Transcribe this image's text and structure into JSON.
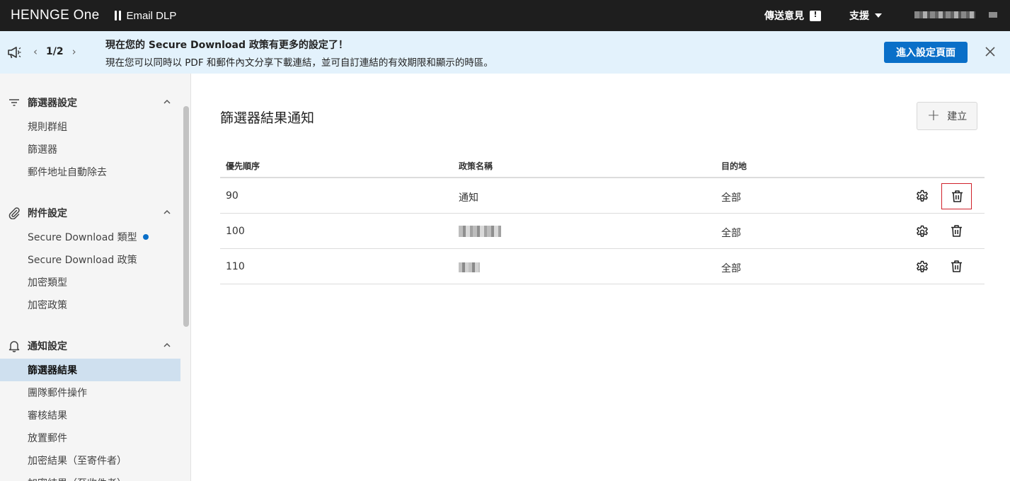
{
  "topbar": {
    "brand": "HENNGE One",
    "product": "Email DLP",
    "feedback_label": "傳送意見",
    "feedback_icon": "feedback-icon",
    "support_label": "支援",
    "colors": {
      "background": "#1e1e1e",
      "text": "#ffffff"
    }
  },
  "announcement": {
    "pager": "1/2",
    "title": "現在您的 Secure Download 政策有更多的設定了！",
    "body": "現在您可以同時以 PDF 和郵件內文分享下載連結，並可自訂連結的有效期限和顯示的時區。",
    "action_label": "進入設定頁面",
    "colors": {
      "background": "#e3f2fc",
      "button": "#0a6fc8"
    }
  },
  "sidebar": {
    "sections": [
      {
        "label": "篩選器設定",
        "icon": "filter-icon",
        "items": [
          "規則群組",
          "篩選器",
          "郵件地址自動除去"
        ]
      },
      {
        "label": "附件設定",
        "icon": "paperclip-icon",
        "items": [
          "Secure Download 類型",
          "Secure Download 政策",
          "加密類型",
          "加密政策"
        ]
      },
      {
        "label": "通知設定",
        "icon": "bell-icon",
        "items": [
          "篩選器結果",
          "團隊郵件操作",
          "審核結果",
          "放置郵件",
          "加密結果（至寄件者）",
          "加密結果（至收件者）"
        ]
      }
    ],
    "active_item": "篩選器結果",
    "colors": {
      "background": "#f5f5f5",
      "active": "#cfe0ef",
      "badge_dot": "#0a6fc8"
    }
  },
  "main": {
    "title": "篩選器結果通知",
    "create_label": "建立",
    "table": {
      "columns": [
        "優先順序",
        "政策名稱",
        "目的地"
      ],
      "rows": [
        {
          "priority": "90",
          "name": "通知",
          "destination": "全部"
        },
        {
          "priority": "100",
          "name": "",
          "destination": "全部"
        },
        {
          "priority": "110",
          "name": "",
          "destination": "全部"
        }
      ]
    },
    "colors": {
      "highlight_border": "#d0202a"
    }
  }
}
